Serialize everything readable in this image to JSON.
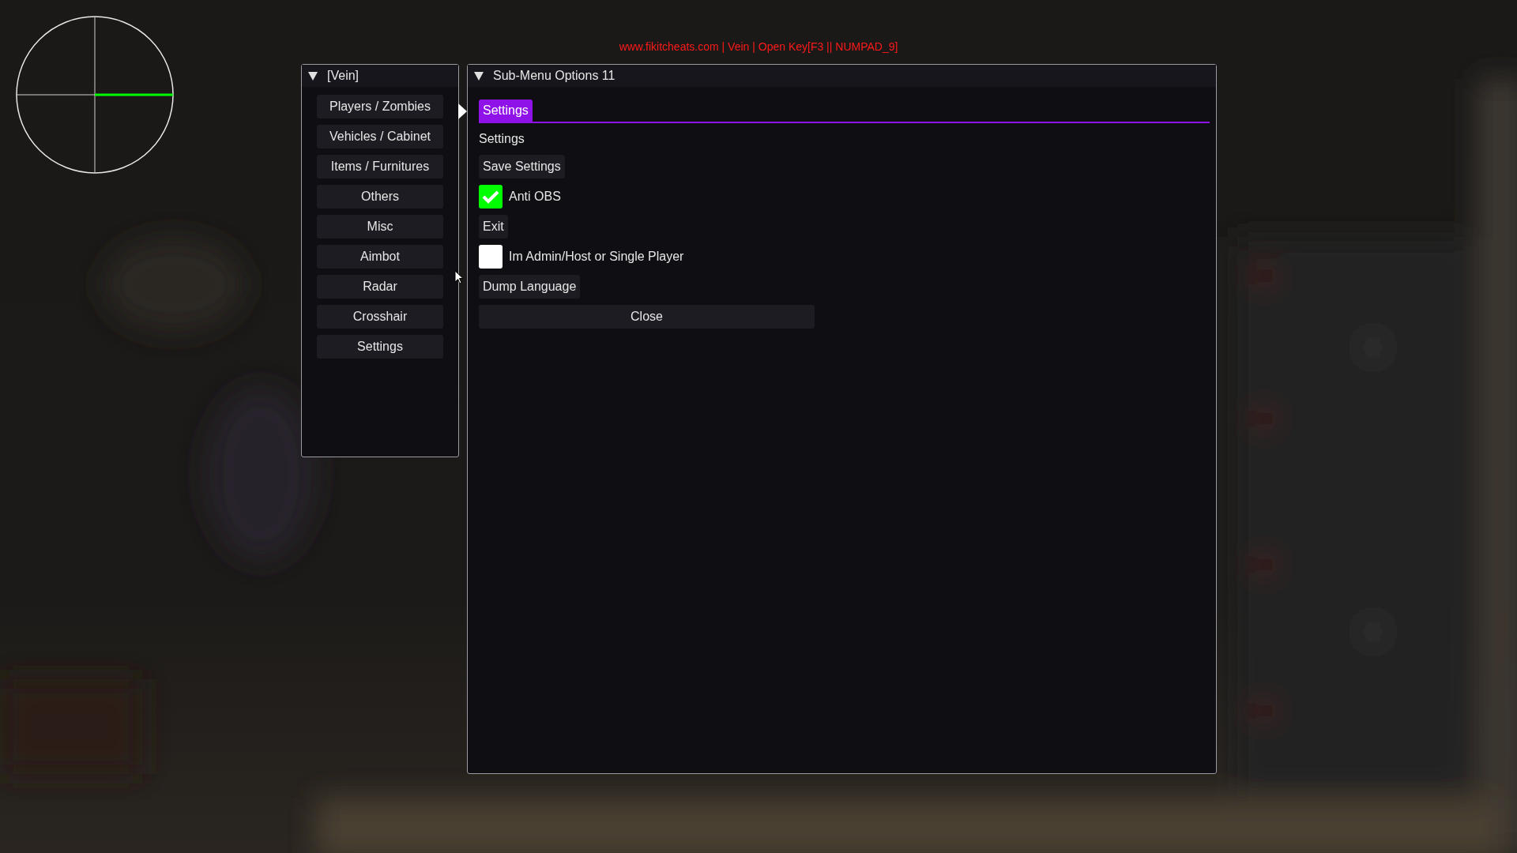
{
  "overlay_banner": "www.fikitcheats.com | Vein | Open Key[F3 || NUMPAD_9]",
  "main_window": {
    "title": "[Vein]",
    "items": [
      {
        "label": "Players / Zombies"
      },
      {
        "label": "Vehicles / Cabinet"
      },
      {
        "label": "Items / Furnitures"
      },
      {
        "label": "Others"
      },
      {
        "label": "Misc"
      },
      {
        "label": "Aimbot"
      },
      {
        "label": "Radar"
      },
      {
        "label": "Crosshair"
      },
      {
        "label": "Settings"
      }
    ]
  },
  "sub_window": {
    "title": "Sub-Menu Options 11",
    "tabs": [
      {
        "label": "Settings",
        "selected": true
      }
    ],
    "section_label": "Settings",
    "controls": [
      {
        "kind": "button",
        "label": "Save Settings"
      },
      {
        "kind": "checkbox",
        "label": "Anti OBS",
        "checked": true
      },
      {
        "kind": "button",
        "label": "Exit"
      },
      {
        "kind": "checkbox",
        "label": "Im Admin/Host or Single Player",
        "checked": false
      },
      {
        "kind": "button",
        "label": "Dump Language"
      },
      {
        "kind": "wide_button",
        "label": "Close"
      }
    ]
  }
}
